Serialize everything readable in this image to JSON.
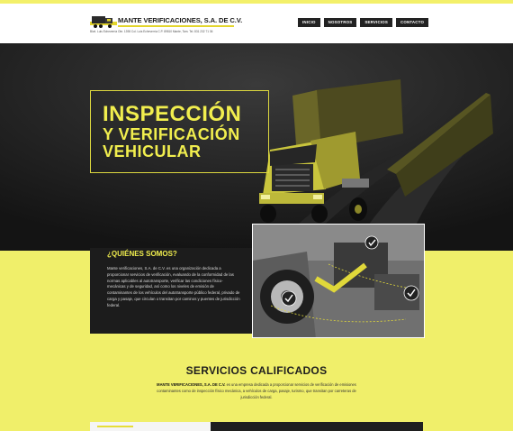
{
  "header": {
    "company_name": "MANTE VERIFICACIONES, S.A. DE C.V.",
    "company_subtitle": "Blvd. Luis Echeverría Ote. 1398 Col. Luis Echeverría C.P. 89810 Mante, Tam. Tel. 831 232 71 36",
    "nav": [
      "INICIO",
      "NOSOTROS",
      "SERVICIOS",
      "CONTACTO"
    ]
  },
  "hero": {
    "title_line1": "INSPECCIÓN",
    "title_line2": "Y VERIFICACIÓN",
    "title_line3": "VEHICULAR"
  },
  "about": {
    "title": "¿QUIÉNES SOMOS?",
    "text": "Mante verificaciones, S.A. de C.V. es una organización dedicada a proporcionar servicios de verificación, evaluando de la conformidad de las normas aplicables al autotransporte, verificar las condiciones físico-mecánicas y de seguridad, así como los niveles de emisión de contaminantes de los vehículos del autotransporte público federal, privado de carga y pasaje, que circulan o transitan por caminos y puentes de jurisdicción federal."
  },
  "services": {
    "title": "SERVICIOS CALIFICADOS",
    "text_strong": "MANTE VERIFICACIONES, S.A. DE C.V.",
    "text_rest": " es una empresa dedicada a proporcionar servicios de verificación de emisiones contaminantes como de inspección físico mecánica, a vehículos de carga, pasaje, turismo, que transitan por carreteras de jurisdicción federal."
  },
  "colors": {
    "accent": "#f1ee4e",
    "dark": "#1c1c1c",
    "yellow_bg": "#f0ef6a"
  }
}
